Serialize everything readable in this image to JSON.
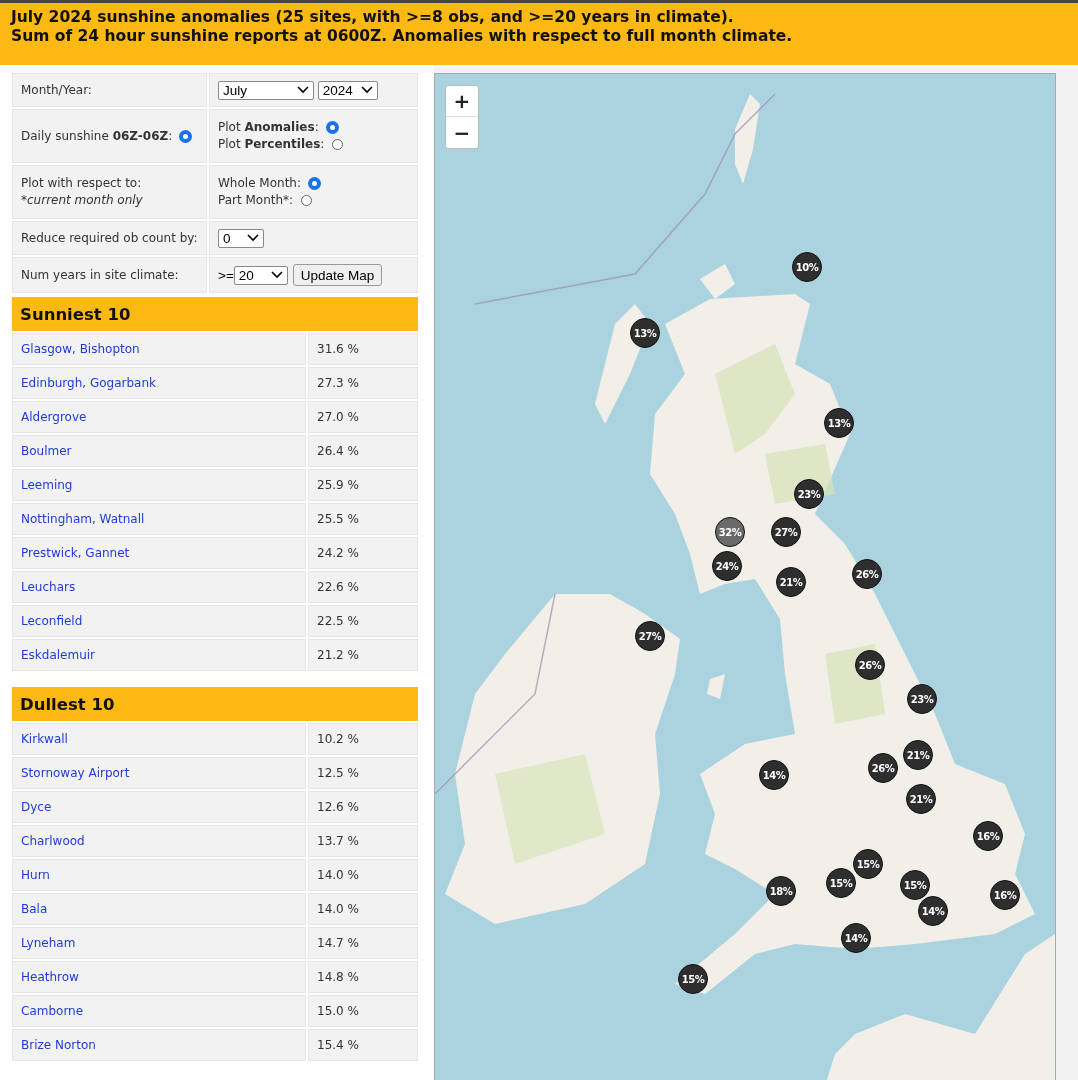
{
  "header": {
    "lines": [
      "July 2024 sunshine anomalies (25 sites, with >=8 obs, and >=20 years in climate).",
      "Sum of 24 hour sunshine reports at 0600Z. Anomalies with respect to full month climate."
    ]
  },
  "form": {
    "month_year": {
      "label": "Month/Year:",
      "month": "July",
      "year": "2024"
    },
    "daily": {
      "label": "Daily sunshine **06Z-06Z**:",
      "selected": true
    },
    "plot_type": {
      "options": [
        {
          "label": "Plot **Anomalies**:",
          "selected": true
        },
        {
          "label": "Plot **Percentiles**:",
          "selected": false
        }
      ]
    },
    "respect": {
      "label": "Plot with respect to:",
      "note": "*current month only",
      "options": [
        {
          "label": "Whole Month:",
          "selected": true
        },
        {
          "label": "Part Month*:",
          "selected": false
        }
      ]
    },
    "reduce": {
      "label": "Reduce required ob count by:",
      "value": "0"
    },
    "years": {
      "label": "Num years in site climate:",
      "prefix": ">=",
      "value": "20",
      "button": "Update Map"
    }
  },
  "sunniest": {
    "title": "Sunniest 10",
    "rows": [
      {
        "site": "Glasgow, Bishopton",
        "value": "31.6 %"
      },
      {
        "site": "Edinburgh, Gogarbank",
        "value": "27.3 %"
      },
      {
        "site": "Aldergrove",
        "value": "27.0 %"
      },
      {
        "site": "Boulmer",
        "value": "26.4 %"
      },
      {
        "site": "Leeming",
        "value": "25.9 %"
      },
      {
        "site": "Nottingham, Watnall",
        "value": "25.5 %"
      },
      {
        "site": "Prestwick, Gannet",
        "value": "24.2 %"
      },
      {
        "site": "Leuchars",
        "value": "22.6 %"
      },
      {
        "site": "Leconfield",
        "value": "22.5 %"
      },
      {
        "site": "Eskdalemuir",
        "value": "21.2 %"
      }
    ]
  },
  "dullest": {
    "title": "Dullest 10",
    "rows": [
      {
        "site": "Kirkwall",
        "value": "10.2 %"
      },
      {
        "site": "Stornoway Airport",
        "value": "12.5 %"
      },
      {
        "site": "Dyce",
        "value": "12.6 %"
      },
      {
        "site": "Charlwood",
        "value": "13.7 %"
      },
      {
        "site": "Hurn",
        "value": "14.0 %"
      },
      {
        "site": "Bala",
        "value": "14.0 %"
      },
      {
        "site": "Lyneham",
        "value": "14.7 %"
      },
      {
        "site": "Heathrow",
        "value": "14.8 %"
      },
      {
        "site": "Camborne",
        "value": "15.0 %"
      },
      {
        "site": "Brize Norton",
        "value": "15.4 %"
      }
    ]
  },
  "map": {
    "zoom_in": "+",
    "zoom_out": "−",
    "markers": [
      {
        "label": "10%",
        "highlighted": false
      },
      {
        "label": "13%",
        "highlighted": false
      },
      {
        "label": "13%",
        "highlighted": false
      },
      {
        "label": "23%",
        "highlighted": false
      },
      {
        "label": "32%",
        "highlighted": true
      },
      {
        "label": "27%",
        "highlighted": false
      },
      {
        "label": "24%",
        "highlighted": false
      },
      {
        "label": "21%",
        "highlighted": false
      },
      {
        "label": "26%",
        "highlighted": false
      },
      {
        "label": "27%",
        "highlighted": false
      },
      {
        "label": "26%",
        "highlighted": false
      },
      {
        "label": "23%",
        "highlighted": false
      },
      {
        "label": "21%",
        "highlighted": false
      },
      {
        "label": "26%",
        "highlighted": false
      },
      {
        "label": "14%",
        "highlighted": false
      },
      {
        "label": "21%",
        "highlighted": false
      },
      {
        "label": "16%",
        "highlighted": false
      },
      {
        "label": "15%",
        "highlighted": false
      },
      {
        "label": "15%",
        "highlighted": false
      },
      {
        "label": "18%",
        "highlighted": false
      },
      {
        "label": "15%",
        "highlighted": false
      },
      {
        "label": "16%",
        "highlighted": false
      },
      {
        "label": "14%",
        "highlighted": false
      },
      {
        "label": "14%",
        "highlighted": false
      },
      {
        "label": "15%",
        "highlighted": false
      }
    ]
  }
}
